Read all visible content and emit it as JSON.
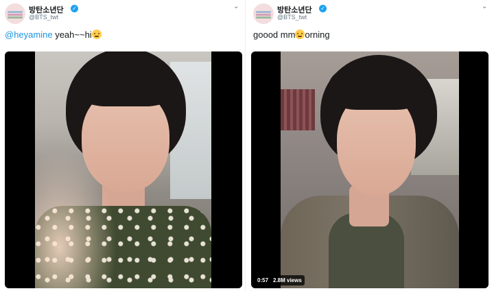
{
  "tweets": [
    {
      "account_name": "방탄소년단",
      "handle": "@BTS_twt",
      "mention": "@heyamine",
      "text": " yeah~~hi",
      "emoji": "thinking-face"
    },
    {
      "account_name": "방탄소년단",
      "handle": "@BTS_twt",
      "text_before": "goood mm",
      "emoji": "woozy-face",
      "text_after": "orning",
      "video_duration": "0:57",
      "video_views": "2.8M views"
    }
  ],
  "icons": {
    "verified": "verified-badge-icon",
    "menu": "chevron-down-icon"
  },
  "glyphs": {
    "verified_check": "✓",
    "chevron": "⌄"
  },
  "colors": {
    "link": "#1b95e0",
    "verified": "#1da1f2",
    "secondary_text": "#657786"
  }
}
